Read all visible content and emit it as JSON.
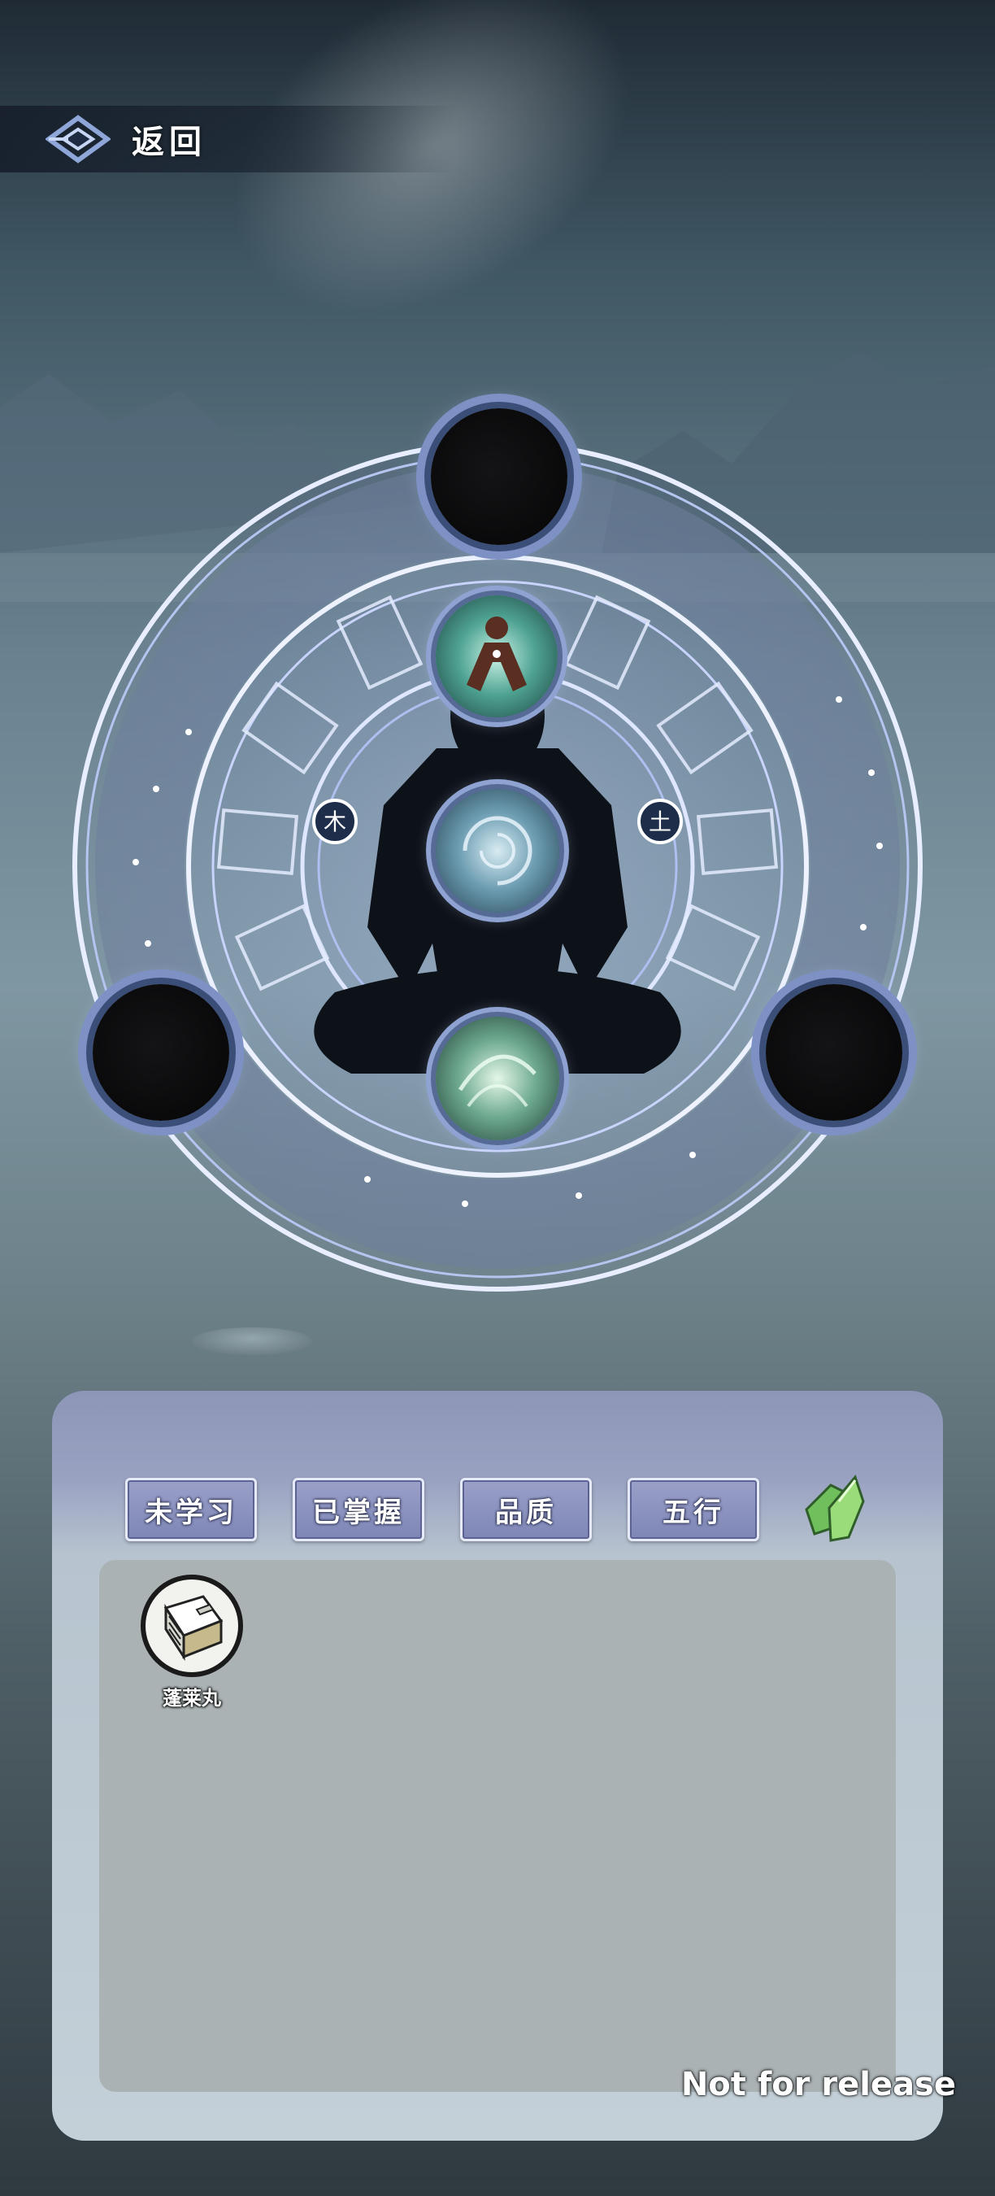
{
  "header": {
    "back_label": "返回",
    "back_icon": "back-arrow-icon"
  },
  "filters": [
    {
      "label": "未学习"
    },
    {
      "label": "已掌握"
    },
    {
      "label": "品质"
    },
    {
      "label": "五行"
    }
  ],
  "filter_icon": "green-crystal-icon",
  "magic_circle": {
    "left_element_label": "木",
    "right_element_label": "土",
    "slots": [
      "top-slot",
      "left-slot",
      "right-slot"
    ],
    "orbs": [
      "head-orb",
      "chest-orb",
      "lower-orb"
    ]
  },
  "inventory": {
    "items": [
      {
        "name": "蓬莱丸",
        "icon": "book-icon"
      }
    ]
  },
  "watermark": "Not for release",
  "colors": {
    "panel": "#aab2b4",
    "button": "#7e86b6",
    "glow": "#cdd8ff"
  }
}
